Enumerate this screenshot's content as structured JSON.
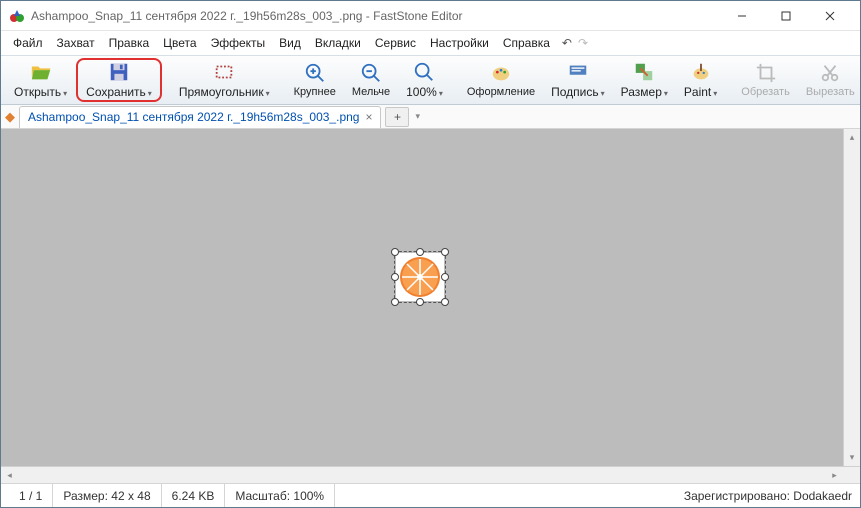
{
  "window": {
    "title": "Ashampoo_Snap_11 сентября 2022 г._19h56m28s_003_.png - FastStone Editor"
  },
  "menu": {
    "file": "Файл",
    "capture": "Захват",
    "edit": "Правка",
    "colors": "Цвета",
    "effects": "Эффекты",
    "view": "Вид",
    "tabs": "Вкладки",
    "service": "Сервис",
    "settings": "Настройки",
    "help": "Справка"
  },
  "toolbar": {
    "open": "Открыть",
    "save": "Сохранить",
    "rectangle": "Прямоугольник",
    "zoomin": "Крупнее",
    "zoomout": "Мельче",
    "zoom100": "100%",
    "draw": "Оформление",
    "caption": "Подпись",
    "resize": "Размер",
    "paint": "Paint",
    "crop": "Обрезать",
    "cut": "Вырезать"
  },
  "tab": {
    "name": "Ashampoo_Snap_11 сентября 2022 г._19h56m28s_003_.png"
  },
  "status": {
    "pages": "1 / 1",
    "size_label": "Размер:",
    "size_value": "42 x 48",
    "filesize": "6.24 KB",
    "scale_label": "Масштаб:",
    "scale_value": "100%",
    "registered": "Зарегистрировано: Dodakaedr"
  }
}
